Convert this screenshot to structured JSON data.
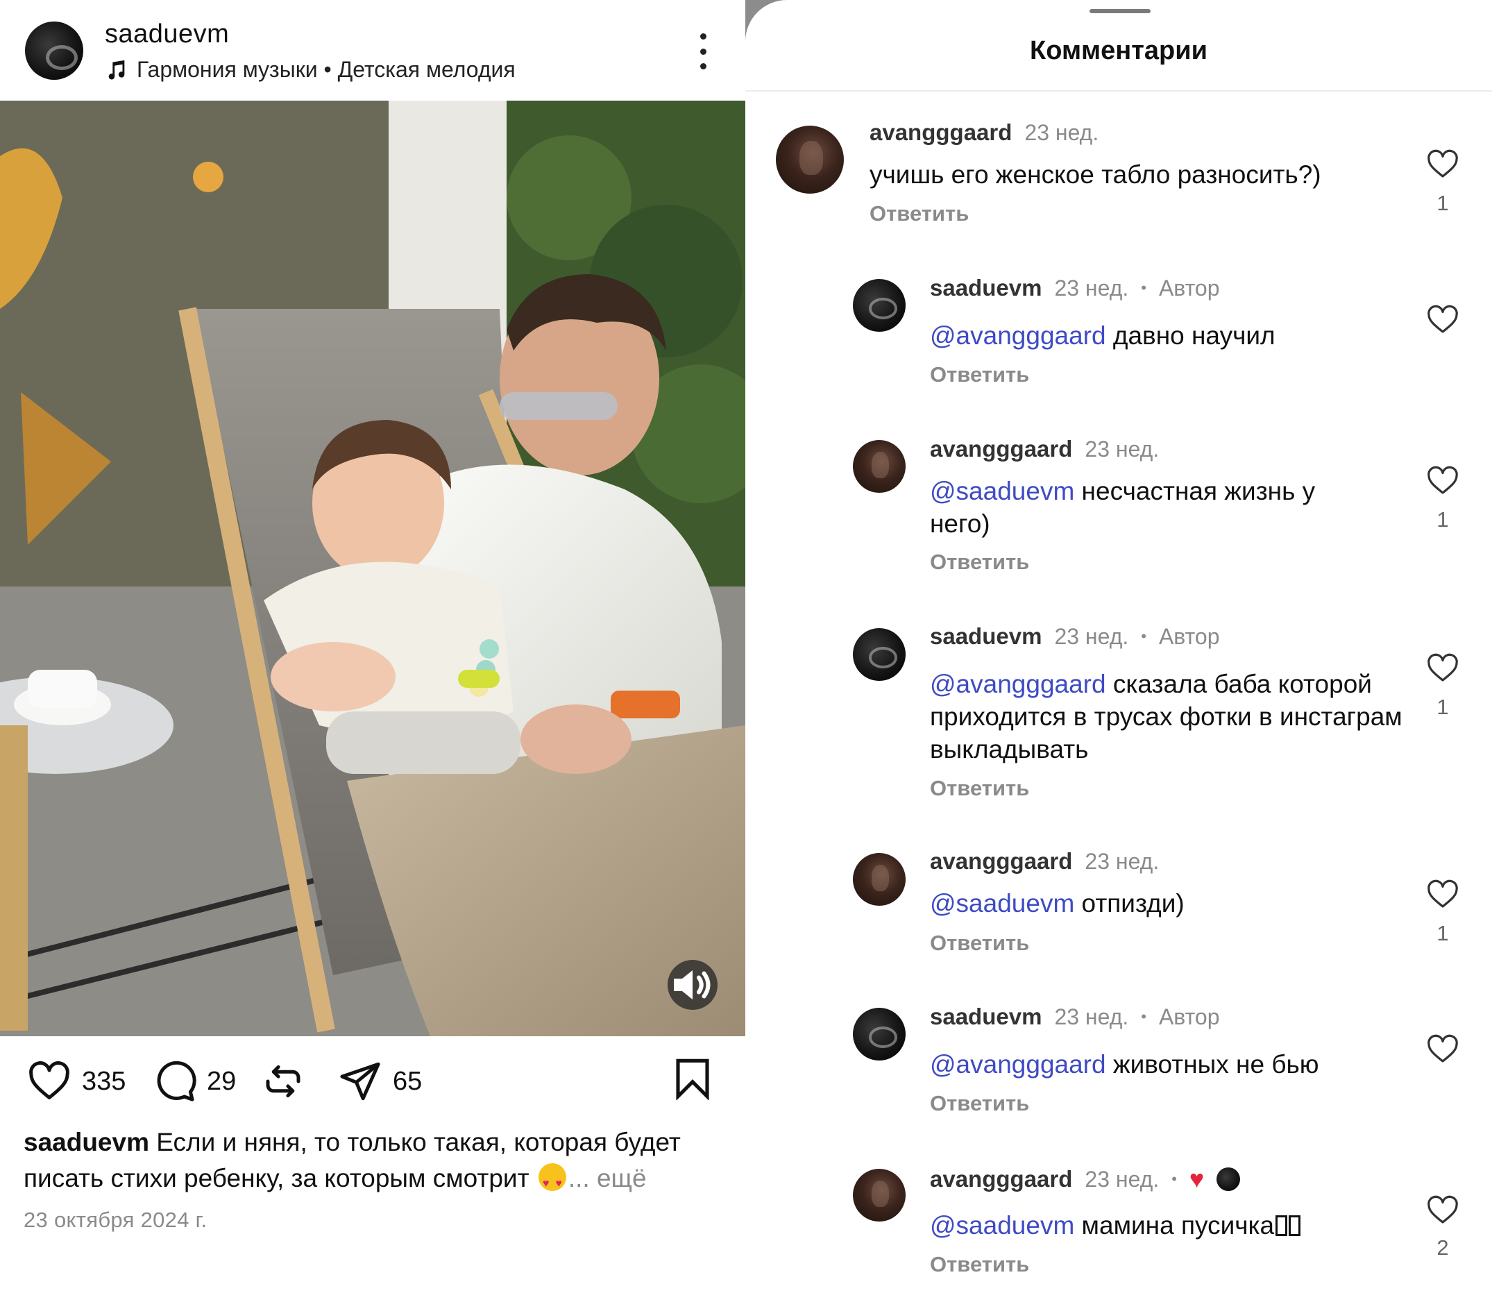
{
  "post": {
    "username": "saaduevm",
    "music": "Гармония музыки • Детская мелодия",
    "likes": "335",
    "comments": "29",
    "shares": "65",
    "caption_user": "saaduevm",
    "caption_text": " Если и няня, то только такая, которая будет писать стихи ребенку, за которым смотрит ",
    "caption_more": "... ещё",
    "date": "23 октября 2024 г.",
    "icons": {
      "music": "music-note-icon",
      "more": "more-vertical-icon",
      "sound": "speaker-icon",
      "like": "heart-icon",
      "comment": "comment-bubble-icon",
      "repost": "repost-icon",
      "share": "send-icon",
      "save": "bookmark-icon"
    }
  },
  "sheet": {
    "title": "Комментарии"
  },
  "comments": [
    {
      "user": "avangggaard",
      "time": "23 нед.",
      "author": "",
      "mention": "",
      "text": "учишь его женское табло разносить?)",
      "reply": "Ответить",
      "likes": "1"
    },
    {
      "user": "saaduevm",
      "time": "23 нед.",
      "author": "Автор",
      "mention": "@avangggaard",
      "text": " давно научил",
      "reply": "Ответить",
      "likes": ""
    },
    {
      "user": "avangggaard",
      "time": "23 нед.",
      "author": "",
      "mention": "@saaduevm",
      "text": " несчастная жизнь у него)",
      "reply": "Ответить",
      "likes": "1"
    },
    {
      "user": "saaduevm",
      "time": "23 нед.",
      "author": "Автор",
      "mention": "@avangggaard",
      "text": " сказала баба которой приходится в трусах фотки в инстаграм выкладывать",
      "reply": "Ответить",
      "likes": "1"
    },
    {
      "user": "avangggaard",
      "time": "23 нед.",
      "author": "",
      "mention": "@saaduevm",
      "text": " отпизди)",
      "reply": "Ответить",
      "likes": "1"
    },
    {
      "user": "saaduevm",
      "time": "23 нед.",
      "author": "Автор",
      "mention": "@avangggaard",
      "text": " животных не бью",
      "reply": "Ответить",
      "likes": ""
    },
    {
      "user": "avangggaard",
      "time": "23 нед.",
      "author": "",
      "mention": "@saaduevm",
      "text": " мамина пусичка",
      "reply": "Ответить",
      "likes": "2"
    }
  ],
  "colors": {
    "mention": "#3f4bc4",
    "muted": "#8a8a8a",
    "liked_by_author": "#e5243b"
  }
}
